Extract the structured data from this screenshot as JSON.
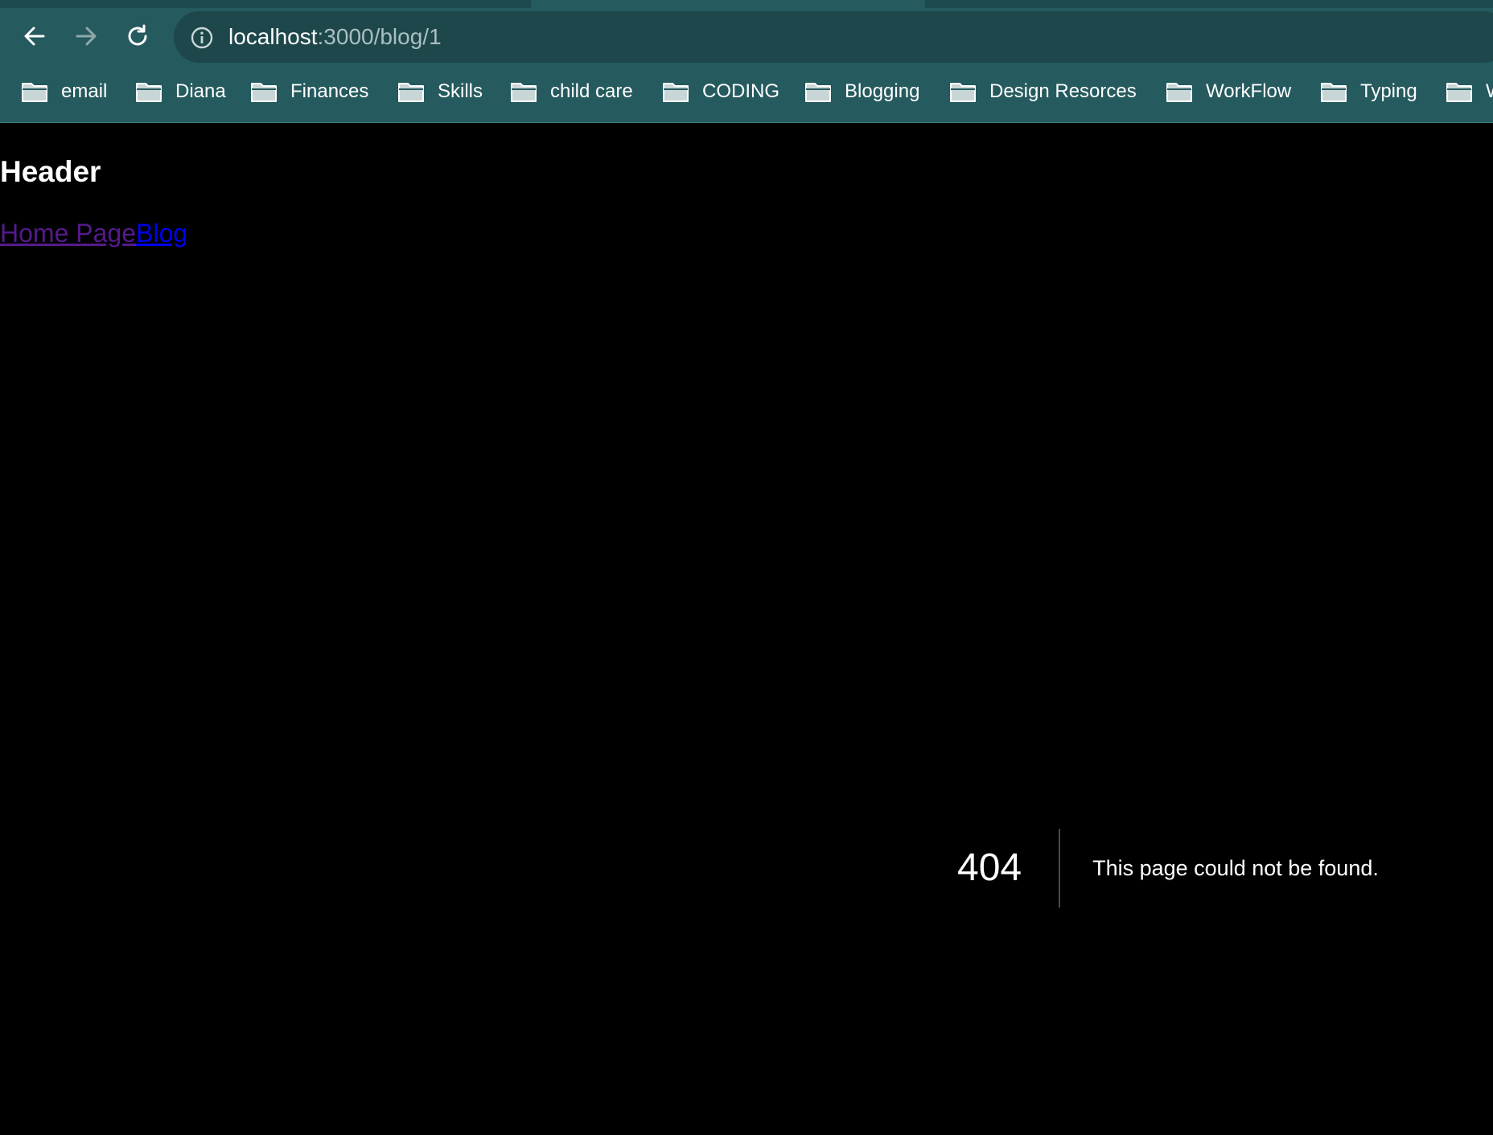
{
  "browser": {
    "address_bar": {
      "host": "localhost",
      "path": ":3000/blog/1"
    },
    "bookmarks": [
      {
        "label": "email"
      },
      {
        "label": "Diana"
      },
      {
        "label": "Finances"
      },
      {
        "label": "Skills"
      },
      {
        "label": "child care"
      },
      {
        "label": "CODING"
      },
      {
        "label": "Blogging"
      },
      {
        "label": "Design Resorces"
      },
      {
        "label": "WorkFlow"
      },
      {
        "label": "Typing"
      },
      {
        "label": "W"
      }
    ],
    "icons": {
      "back": "arrow-left-icon",
      "forward": "arrow-right-icon",
      "reload": "reload-icon",
      "site_info": "info-icon",
      "bookmark_folder": "folder-icon"
    }
  },
  "page": {
    "header_title": "Header",
    "nav": {
      "home_link": "Home Page",
      "blog_link": "Blog"
    },
    "error": {
      "code": "404",
      "message": "This page could not be found."
    }
  },
  "colors": {
    "chrome_background": "#255a5e",
    "omnibox_background": "#1e474b",
    "page_background": "#000000",
    "visited_link": "#551a8b",
    "unvisited_link": "#0000ee"
  }
}
